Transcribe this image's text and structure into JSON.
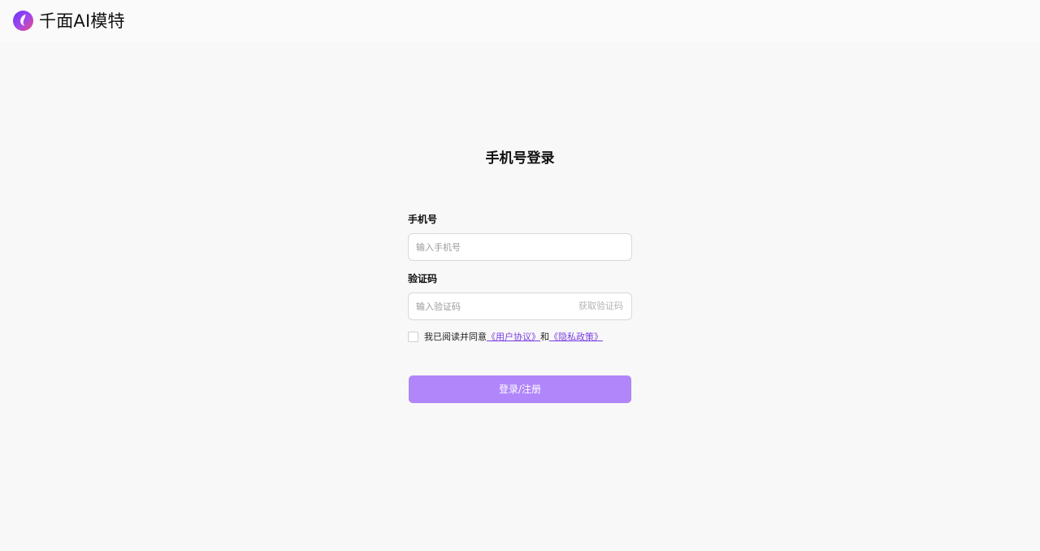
{
  "header": {
    "brand": "千面AI模特",
    "logo_colors": [
      "#7a3cff",
      "#e0467d"
    ]
  },
  "login": {
    "title": "手机号登录",
    "phone_label": "手机号",
    "phone_placeholder": "输入手机号",
    "code_label": "验证码",
    "code_placeholder": "输入验证码",
    "get_code": "获取验证码",
    "agree_prefix": "我已阅读并同意",
    "user_agreement": "《用户协议》",
    "agree_and": "和",
    "privacy_policy": "《隐私政策》",
    "submit_label": "登录/注册",
    "accent_color": "#b086fa"
  }
}
